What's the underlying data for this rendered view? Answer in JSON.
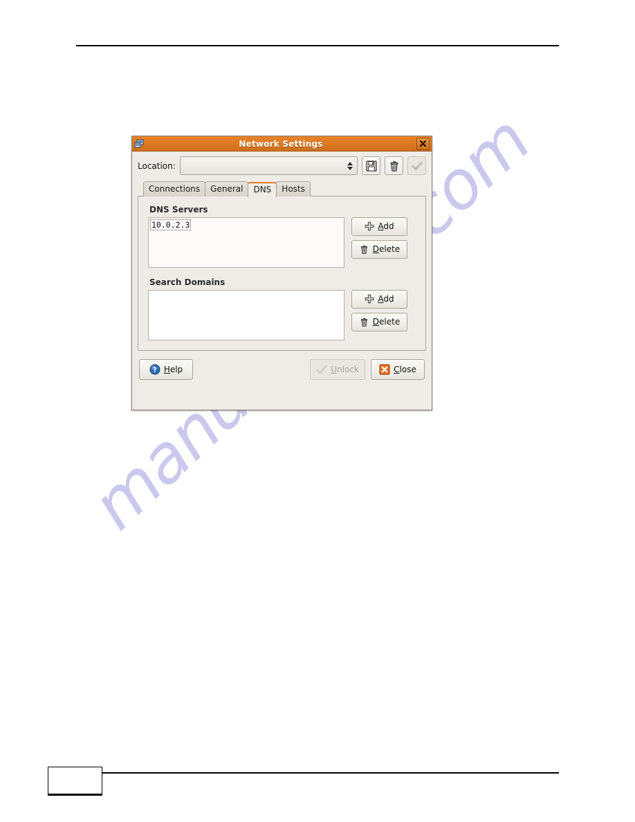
{
  "page": {
    "page_number": "",
    "watermark": "manualshive.com"
  },
  "dialog": {
    "title": "Network Settings",
    "window_icon": "network-settings-icon",
    "close_icon": "close-icon",
    "close_label": "x",
    "location": {
      "label": "Location:",
      "value": "",
      "placeholder": "",
      "spinner_icon": "spinner-up-down-icon"
    },
    "toolbar": [
      {
        "name": "save-button",
        "icon": "floppy-disk-icon",
        "disabled": false
      },
      {
        "name": "delete-location-button",
        "icon": "trash-can-icon",
        "disabled": false
      },
      {
        "name": "apply-button",
        "icon": "check-mark-icon",
        "disabled": true
      }
    ],
    "tabs": [
      {
        "label": "Connections",
        "active": false
      },
      {
        "label": "General",
        "active": false
      },
      {
        "label": "DNS",
        "active": true
      },
      {
        "label": "Hosts",
        "active": false
      }
    ],
    "dns_tab": {
      "dns_servers": {
        "title": "DNS Servers",
        "items": [
          "10.0.2.3"
        ],
        "selected_index": 0,
        "add_label": "Add",
        "add_mnemonic": "A",
        "add_icon": "plus-icon",
        "delete_label": "Delete",
        "delete_mnemonic": "D",
        "delete_icon": "trash-can-icon"
      },
      "search_domains": {
        "title": "Search Domains",
        "items": [],
        "add_label": "Add",
        "add_mnemonic": "A",
        "add_icon": "plus-icon",
        "delete_label": "Delete",
        "delete_mnemonic": "D",
        "delete_icon": "trash-can-icon"
      }
    },
    "footer": {
      "help_label": "Help",
      "help_mnemonic": "H",
      "help_icon": "help-question-icon",
      "unlock_label": "Unlock",
      "unlock_mnemonic": "U",
      "unlock_icon": "unlock-key-icon",
      "unlock_disabled": true,
      "close_label": "Close",
      "close_mnemonic": "C",
      "close_icon": "close-x-icon"
    }
  },
  "colors": {
    "titlebar_orange": "#dd7a22",
    "tab_active_accent": "#e07b1e",
    "close_icon_orange": "#e8701c",
    "help_icon_blue": "#2a6fbd",
    "watermark": "#b9b8e8"
  }
}
